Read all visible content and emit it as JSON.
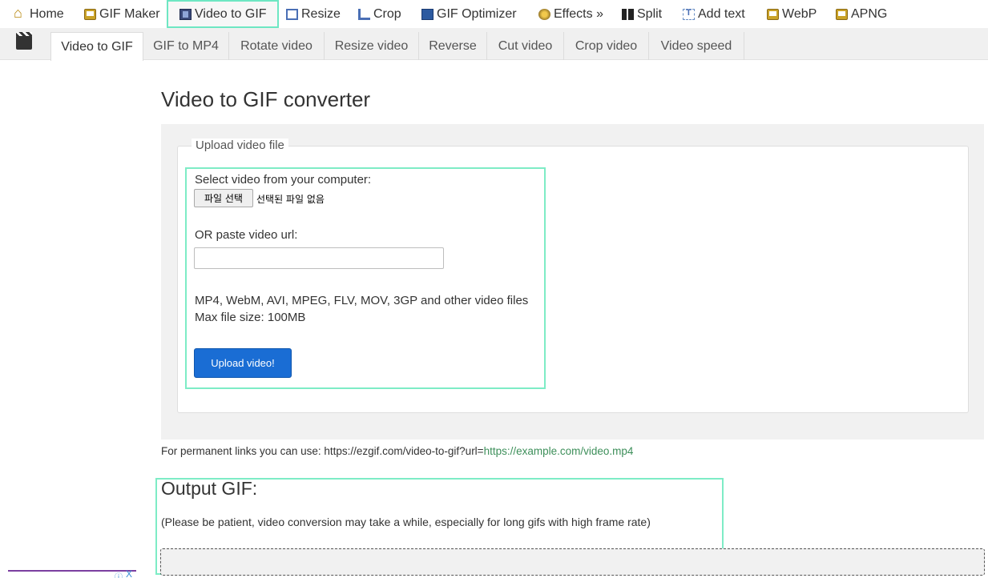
{
  "topnav": {
    "items": [
      {
        "label": "Home",
        "icon": "home-icon"
      },
      {
        "label": "GIF Maker",
        "icon": "gif-maker-icon"
      },
      {
        "label": "Video to GIF",
        "icon": "film-icon",
        "active": true
      },
      {
        "label": "Resize",
        "icon": "resize-icon"
      },
      {
        "label": "Crop",
        "icon": "crop-icon"
      },
      {
        "label": "GIF Optimizer",
        "icon": "optimizer-icon"
      },
      {
        "label": "Effects »",
        "icon": "effects-icon"
      },
      {
        "label": "Split",
        "icon": "split-icon"
      },
      {
        "label": "Add text",
        "icon": "add-text-icon"
      },
      {
        "label": "WebP",
        "icon": "webp-icon"
      },
      {
        "label": "APNG",
        "icon": "apng-icon"
      }
    ]
  },
  "subnav": {
    "icon": "clapperboard-icon",
    "tabs": [
      {
        "label": "Video to GIF",
        "active": true
      },
      {
        "label": "GIF to MP4"
      },
      {
        "label": "Rotate video"
      },
      {
        "label": "Resize video"
      },
      {
        "label": "Reverse"
      },
      {
        "label": "Cut video"
      },
      {
        "label": "Crop video"
      },
      {
        "label": "Video speed"
      }
    ]
  },
  "page": {
    "title": "Video to GIF converter"
  },
  "upload": {
    "legend": "Upload video file",
    "select_label": "Select video from your computer:",
    "file_button": "파일 선택",
    "file_status": "선택된 파일 없음",
    "url_label": "OR paste video url:",
    "url_value": "",
    "formats": "MP4, WebM, AVI, MPEG, FLV, MOV, 3GP and other video files",
    "max_size": "Max file size: 100MB",
    "submit_label": "Upload video!"
  },
  "permanent": {
    "prefix": "For permanent links you can use: https://ezgif.com/video-to-gif?url=",
    "example": "https://example.com/video.mp4"
  },
  "output": {
    "title": "Output GIF:",
    "note": "(Please be patient, video conversion may take a while, especially for long gifs with high frame rate)"
  },
  "ad": {
    "info_glyph": "ⓘ",
    "close_glyph": "X"
  },
  "colors": {
    "accent": "#1a6dd4",
    "highlight": "#7eecc6",
    "link_green": "#3d8f5a"
  }
}
